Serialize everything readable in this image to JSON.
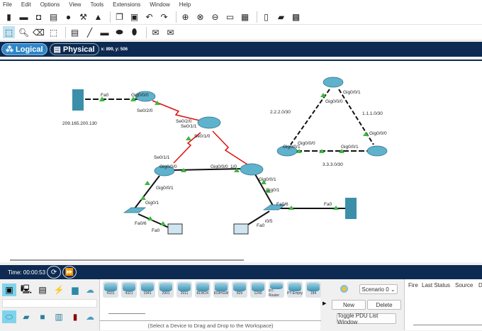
{
  "menu": [
    "File",
    "Edit",
    "Options",
    "View",
    "Tools",
    "Extensions",
    "Window",
    "Help"
  ],
  "nav": {
    "logical": "Logical",
    "physical": "Physical",
    "coords": "x: 899, y: 506"
  },
  "topology": {
    "server1_ip": "209.165.200.130",
    "labels": {
      "fa0_srv1": "Fa0",
      "r1_gig000": "Gig0/0/0",
      "r1_se020": "Se0/2/0",
      "r2_se020": "Se0/2/0",
      "r2_se011": "Se0/1/1",
      "r2_se010": "Se0/1/0",
      "r3_se011": "Se0/1/1",
      "r3_gig000": "Gig0/0/0",
      "r4_gig000": "Gig0/0/0",
      "r4_se": "1/0",
      "r3_gig001": "Gig0/0/1",
      "sw1_gig01": "Gig0/1",
      "sw1_fa06": "Fa0/6",
      "pc1_fa0": "Fa0",
      "r4_gig001": "Gig0/0/1",
      "sw2_gig01": "Gig0/1",
      "sw2_fa06": "Fa0/6",
      "srv2_fa0": "Fa0",
      "pc2_fa0": "Fa0",
      "sw2_fa05": "i0/5",
      "net1": "2.2.2.0/30",
      "net2": "1.1.1.0/30",
      "net3": "3.3.3.0/30",
      "top_gig001": "Gig0/0/1",
      "top_gig000": "Gig0/0/0",
      "right_gig000": "Gig0/0/0",
      "right_gig001": "Gig0/0/1",
      "left_gig001": "Gig0/0/1",
      "left_gig000": "Gig0/0/0"
    }
  },
  "time": {
    "label": "Time: 00:00:53"
  },
  "devices": [
    "4331",
    "4321",
    "1941",
    "2901",
    "2911",
    "819IOX",
    "819HGW",
    "829",
    "1240",
    "PT-Router",
    "PT-Empty",
    "184"
  ],
  "hint": "(Select a Device to Drag and Drop to the Workspace)",
  "scenario": {
    "selected": "Scenario 0",
    "new": "New",
    "delete": "Delete",
    "toggle": "Toggle PDU List Window"
  },
  "pdu_columns": [
    "Fire",
    "Last Status",
    "Source",
    "D"
  ],
  "colors": {
    "nav": "#0d2a52",
    "serial": "#e01010",
    "link_up": "#3cb83c"
  }
}
